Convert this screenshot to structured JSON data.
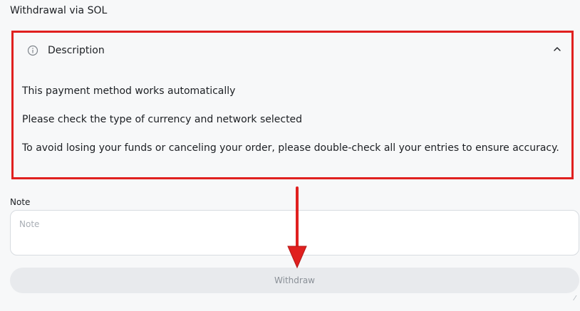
{
  "header": {
    "title": "Withdrawal via SOL"
  },
  "description": {
    "title": "Description",
    "icon": "info-icon",
    "toggle_icon": "chevron-up-icon",
    "lines": [
      "This payment method works automatically",
      "Please check the type of currency and network selected",
      "To avoid losing your funds or canceling your order, please double-check all your entries to ensure accuracy."
    ]
  },
  "note": {
    "label": "Note",
    "placeholder": "Note",
    "value": ""
  },
  "actions": {
    "withdraw_label": "Withdraw"
  },
  "colors": {
    "annotation_red": "#e0201f",
    "disabled_button_bg": "#e8eaed",
    "disabled_button_text": "#8a9097"
  }
}
